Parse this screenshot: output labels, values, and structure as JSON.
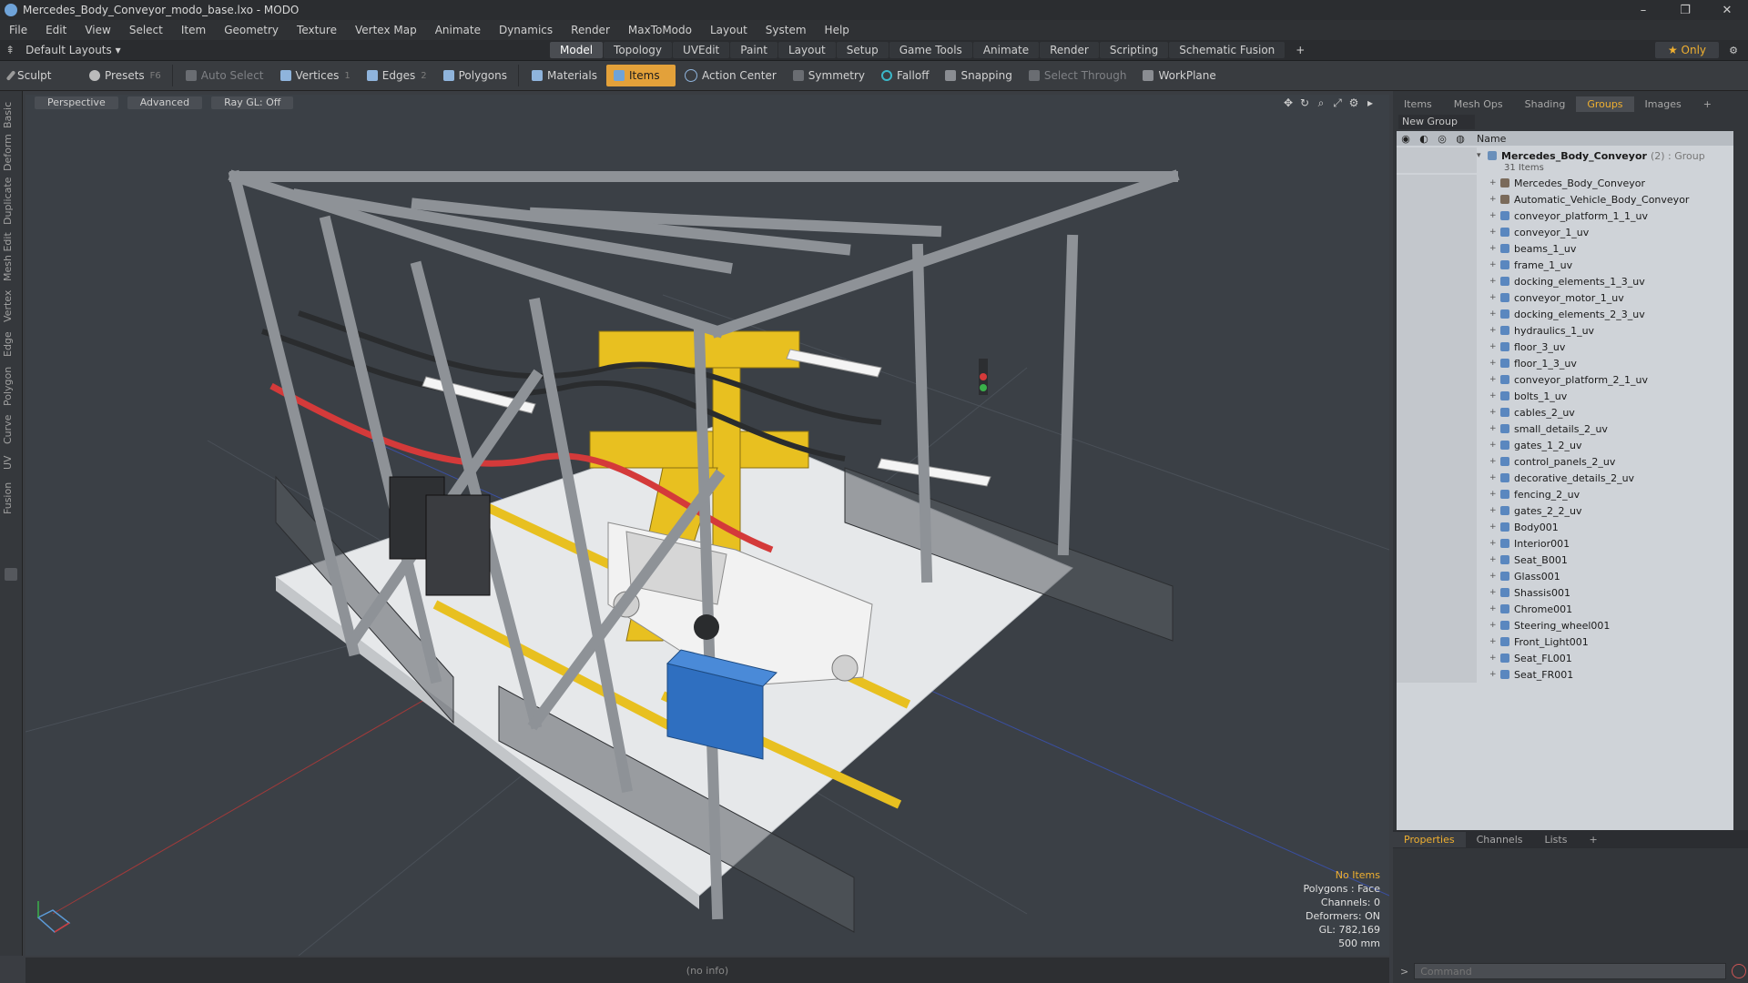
{
  "window": {
    "title": "Mercedes_Body_Conveyor_modo_base.lxo - MODO",
    "minimize": "–",
    "restore": "❐",
    "close": "✕"
  },
  "menu": [
    "File",
    "Edit",
    "View",
    "Select",
    "Item",
    "Geometry",
    "Texture",
    "Vertex Map",
    "Animate",
    "Dynamics",
    "Render",
    "MaxToModo",
    "Layout",
    "System",
    "Help"
  ],
  "layout": {
    "selector": "Default Layouts ▾",
    "tabs": [
      "Model",
      "Topology",
      "UVEdit",
      "Paint",
      "Layout",
      "Setup",
      "Game Tools",
      "Animate",
      "Render",
      "Scripting",
      "Schematic Fusion",
      "+"
    ],
    "active_tab": "Model",
    "only": "★  Only"
  },
  "toolbar": {
    "sculpt": "Sculpt",
    "presets": "Presets",
    "presets_key": "F6",
    "auto_select": "Auto Select",
    "vertices": "Vertices",
    "vertices_key": "1",
    "edges": "Edges",
    "edges_key": "2",
    "polygons": "Polygons",
    "materials": "Materials",
    "items": "Items",
    "action_center": "Action Center",
    "symmetry": "Symmetry",
    "falloff": "Falloff",
    "snapping": "Snapping",
    "select_through": "Select Through",
    "workplane": "WorkPlane"
  },
  "left_tabs": [
    "Basic",
    "Deform",
    "Duplicate",
    "Mesh Edit",
    "Vertex",
    "Edge",
    "Polygon",
    "Curve",
    "UV",
    "Fusion"
  ],
  "viewport": {
    "view_mode": "Perspective",
    "shading": "Advanced",
    "raygl": "Ray GL: Off",
    "info": {
      "selection": "No Items",
      "polygons": "Polygons : Face",
      "channels": "Channels: 0",
      "deformers": "Deformers: ON",
      "gl": "GL: 782,169",
      "scale": "500 mm"
    }
  },
  "status": "(no info)",
  "right_panel": {
    "tabs": [
      "Items",
      "Mesh Ops",
      "Shading",
      "Groups",
      "Images",
      "+"
    ],
    "active_tab": "Groups",
    "new_group": "New Group",
    "column_name": "Name",
    "group_name": "Mercedes_Body_Conveyor",
    "group_meta": "(2) : Group",
    "group_count": "31 Items",
    "items": [
      "Mercedes_Body_Conveyor",
      "Automatic_Vehicle_Body_Conveyor",
      "conveyor_platform_1_1_uv",
      "conveyor_1_uv",
      "beams_1_uv",
      "frame_1_uv",
      "docking_elements_1_3_uv",
      "conveyor_motor_1_uv",
      "docking_elements_2_3_uv",
      "hydraulics_1_uv",
      "floor_3_uv",
      "floor_1_3_uv",
      "conveyor_platform_2_1_uv",
      "bolts_1_uv",
      "cables_2_uv",
      "small_details_2_uv",
      "gates_1_2_uv",
      "control_panels_2_uv",
      "decorative_details_2_uv",
      "fencing_2_uv",
      "gates_2_2_uv",
      "Body001",
      "Interior001",
      "Seat_B001",
      "Glass001",
      "Shassis001",
      "Chrome001",
      "Steering_wheel001",
      "Front_Light001",
      "Seat_FL001",
      "Seat_FR001"
    ],
    "bottom_tabs": [
      "Properties",
      "Channels",
      "Lists",
      "+"
    ],
    "bottom_active": "Properties",
    "command_placeholder": "Command"
  },
  "colors": {
    "accent": "#e3a13a",
    "highlight_text": "#f0b030",
    "viewport_bg": "#3b4046"
  }
}
